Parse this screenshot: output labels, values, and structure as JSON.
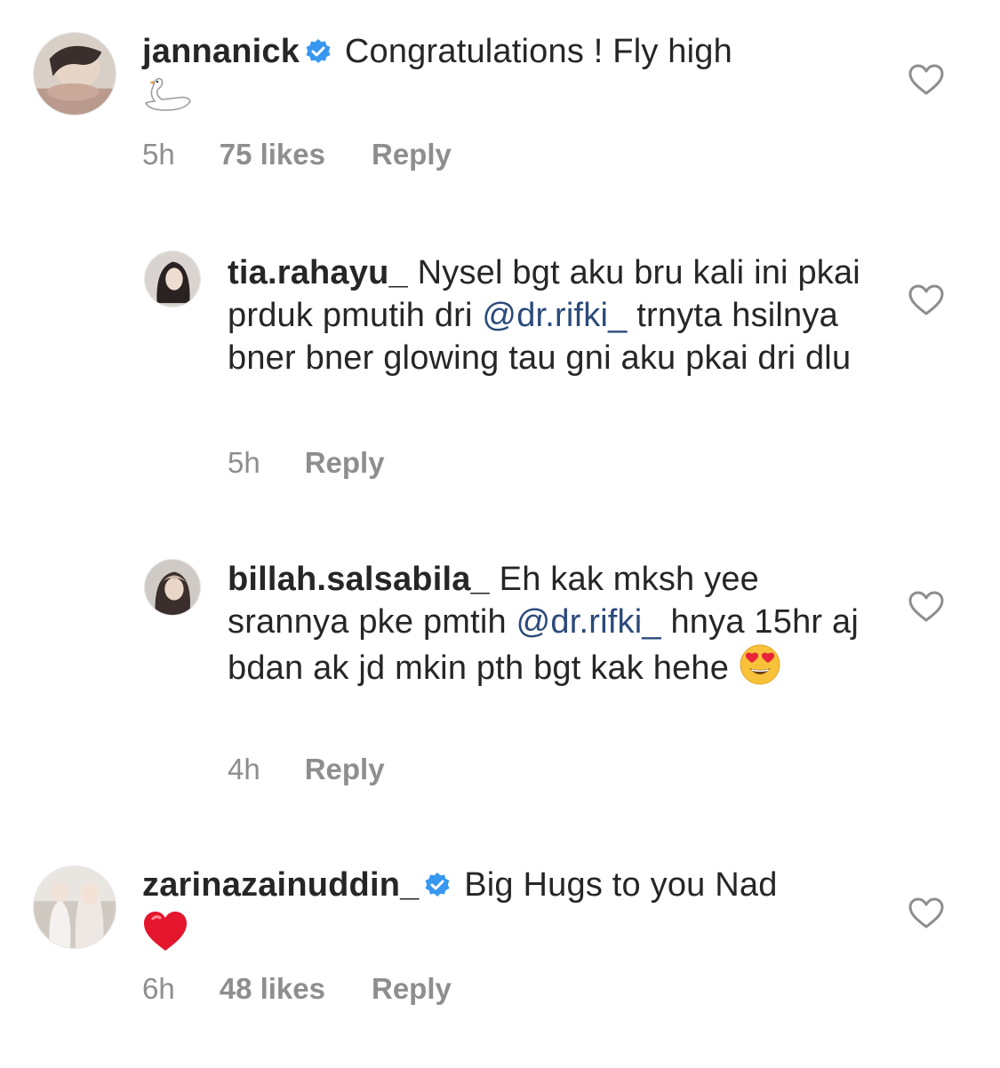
{
  "comments": [
    {
      "username": "jannanick",
      "verified": true,
      "text": "Congratulations ! Fly high",
      "emoji": "swan",
      "time": "5h",
      "likes": "75 likes",
      "reply_label": "Reply"
    },
    {
      "username": "tia.rahayu_",
      "verified": false,
      "text_parts": [
        "Nysel bgt aku bru kali ini pkai prduk pmutih dri ",
        "@dr.rifki_",
        " trnyta hsilnya bner bner glowing tau gni aku pkai dri dlu"
      ],
      "time": "5h",
      "reply_label": "Reply"
    },
    {
      "username": "billah.salsabila_",
      "verified": false,
      "text_parts": [
        "Eh kak mksh yee srannya pke pmtih ",
        "@dr.rifki_",
        " hnya 15hr aj bdan ak jd mkin pth bgt kak hehe "
      ],
      "emoji": "heart-eyes-face",
      "time": "4h",
      "reply_label": "Reply"
    },
    {
      "username": "zarinazainuddin_",
      "verified": true,
      "text": "Big Hugs to you Nad",
      "emoji": "red-heart",
      "time": "6h",
      "likes": "48 likes",
      "reply_label": "Reply"
    }
  ],
  "colors": {
    "text": "#262626",
    "meta": "#8e8e8e",
    "mention": "#2b4a7a",
    "verified": "#3897f0",
    "heart_outline": "#8e8e8e"
  }
}
